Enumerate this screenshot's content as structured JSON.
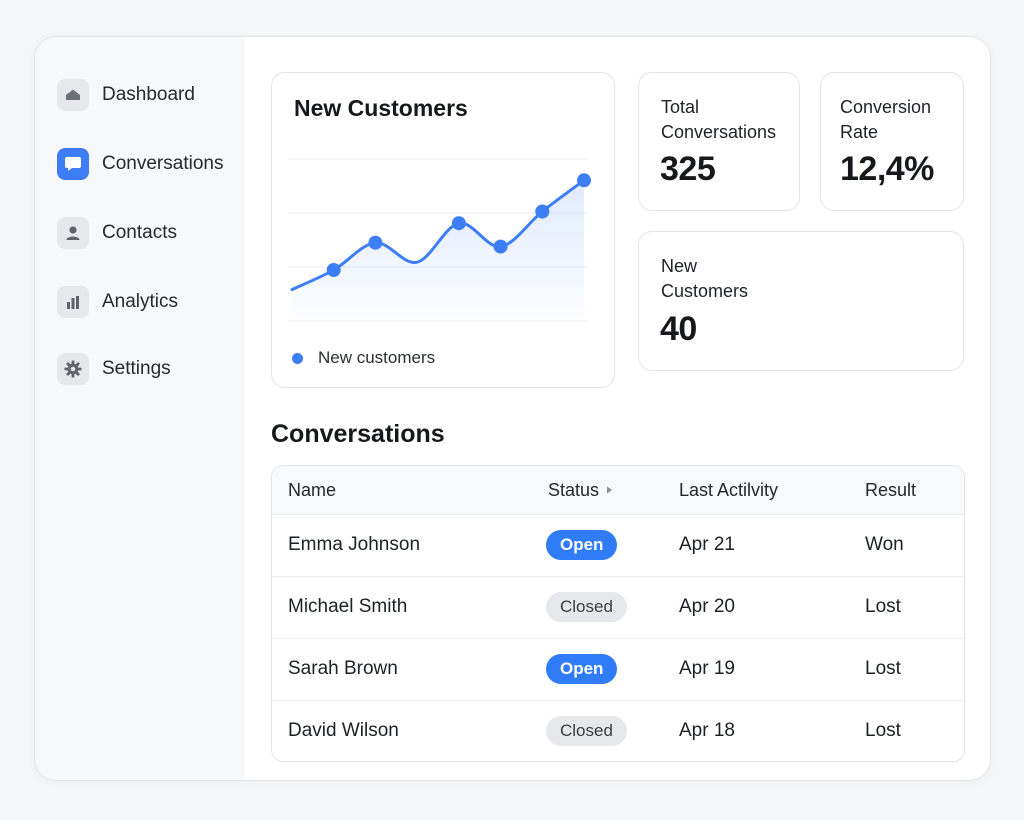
{
  "sidebar": {
    "items": [
      {
        "label": "Dashboard",
        "icon": "home-icon",
        "active": false
      },
      {
        "label": "Conversations",
        "icon": "chat-bubble-icon",
        "active": true
      },
      {
        "label": "Contacts",
        "icon": "person-icon",
        "active": false
      },
      {
        "label": "Analytics",
        "icon": "bar-chart-icon",
        "active": false
      },
      {
        "label": "Settings",
        "icon": "gear-icon",
        "active": false
      }
    ]
  },
  "chart_card": {
    "title": "New Customers",
    "legend": "New customers"
  },
  "chart_data": {
    "type": "line",
    "title": "New Customers",
    "series": [
      {
        "name": "New customers",
        "values": [
          5,
          10,
          17,
          12,
          22,
          16,
          25,
          33
        ]
      }
    ],
    "markers": [
      false,
      true,
      true,
      false,
      true,
      true,
      true,
      true
    ],
    "ylim": [
      0,
      40
    ],
    "grid": true,
    "legend_position": "bottom-left",
    "fill": "area"
  },
  "stats": {
    "total_conversations": {
      "label": "Total\nConversations",
      "value": "325"
    },
    "conversion_rate": {
      "label": "Conversion\nRate",
      "value": "12,4%"
    },
    "new_customers": {
      "label": "New\nCustomers",
      "value": "40"
    }
  },
  "table": {
    "title": "Conversations",
    "headers": {
      "name": "Name",
      "status": "Status",
      "last_activity": "Last Actilvity",
      "result": "Result"
    },
    "rows": [
      {
        "name": "Emma Johnson",
        "status": "Open",
        "status_kind": "open",
        "last_activity": "Apr 21",
        "result": "Won"
      },
      {
        "name": "Michael Smith",
        "status": "Closed",
        "status_kind": "closed",
        "last_activity": "Apr 20",
        "result": "Lost"
      },
      {
        "name": "Sarah Brown",
        "status": "Open",
        "status_kind": "open",
        "last_activity": "Apr 19",
        "result": "Lost"
      },
      {
        "name": "David Wilson",
        "status": "Closed",
        "status_kind": "closed",
        "last_activity": "Apr 18",
        "result": "Lost"
      }
    ]
  },
  "colors": {
    "accent": "#3d7ef5",
    "closed_badge": "#e6e8eb"
  }
}
